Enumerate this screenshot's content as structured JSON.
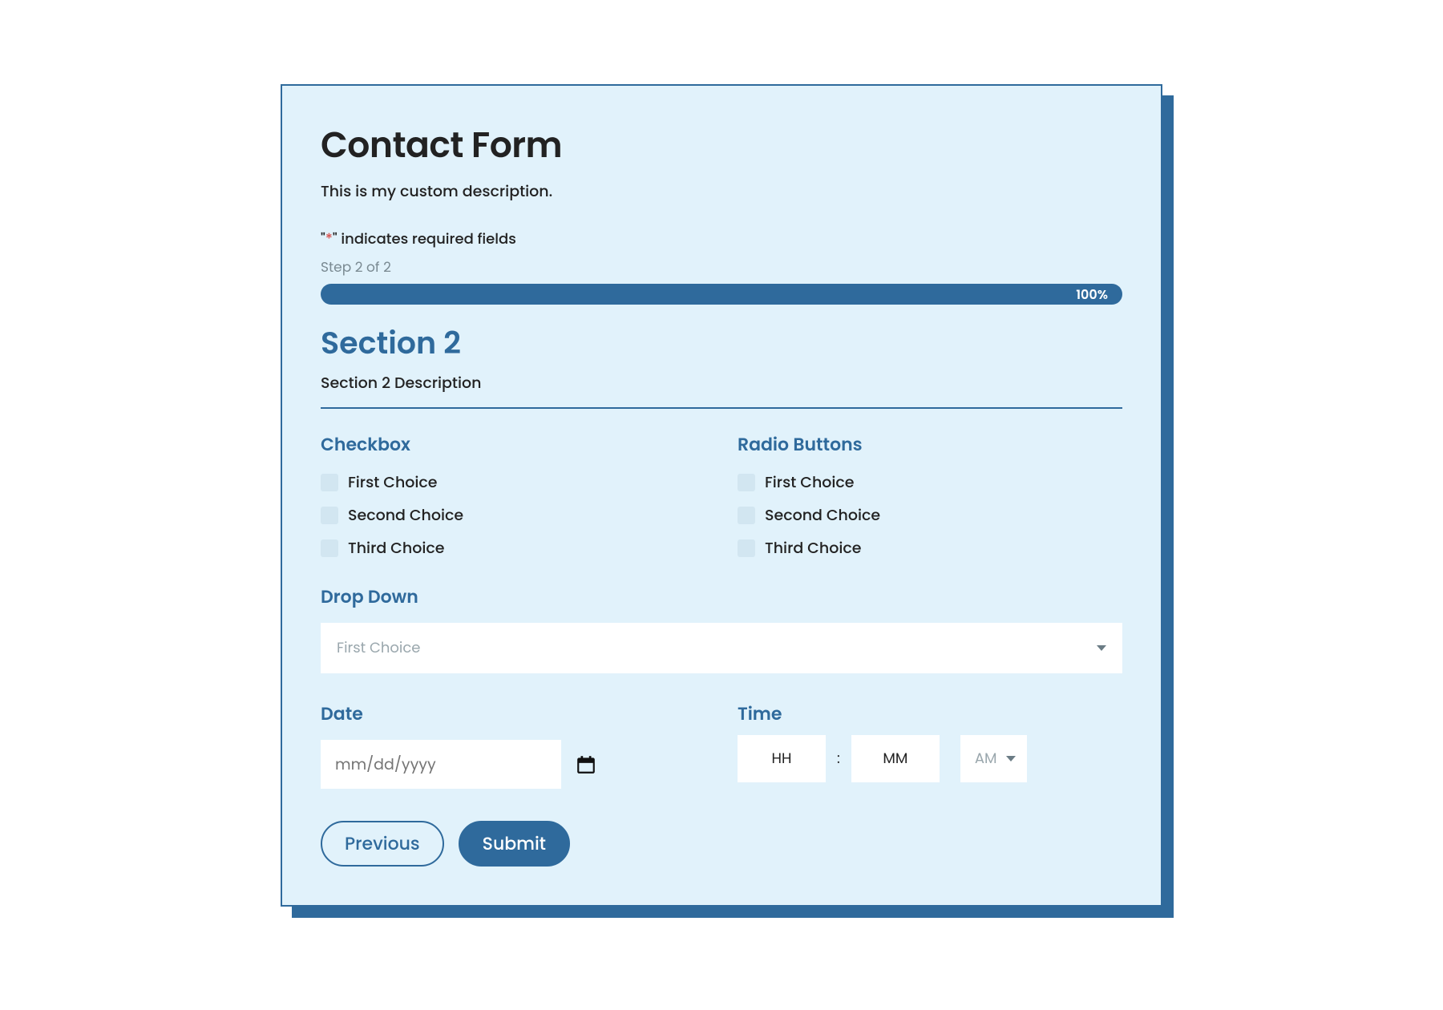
{
  "form": {
    "title": "Contact Form",
    "description": "This is my custom description.",
    "required_note_quote_open": "\"",
    "required_note_asterisk": "*",
    "required_note_quote_close": "\"",
    "required_note_text": " indicates required fields",
    "step_label": "Step 2 of 2",
    "progress_percent": "100%"
  },
  "section": {
    "title": "Section 2",
    "description": "Section 2 Description"
  },
  "checkbox": {
    "label": "Checkbox",
    "options": [
      "First Choice",
      "Second Choice",
      "Third Choice"
    ]
  },
  "radio": {
    "label": "Radio Buttons",
    "options": [
      "First Choice",
      "Second Choice",
      "Third Choice"
    ]
  },
  "dropdown": {
    "label": "Drop Down",
    "selected": "First Choice"
  },
  "date": {
    "label": "Date",
    "placeholder": "mm/dd/yyyy"
  },
  "time": {
    "label": "Time",
    "hh_placeholder": "HH",
    "mm_placeholder": "MM",
    "colon": ":",
    "ampm": "AM"
  },
  "buttons": {
    "previous": "Previous",
    "submit": "Submit"
  }
}
